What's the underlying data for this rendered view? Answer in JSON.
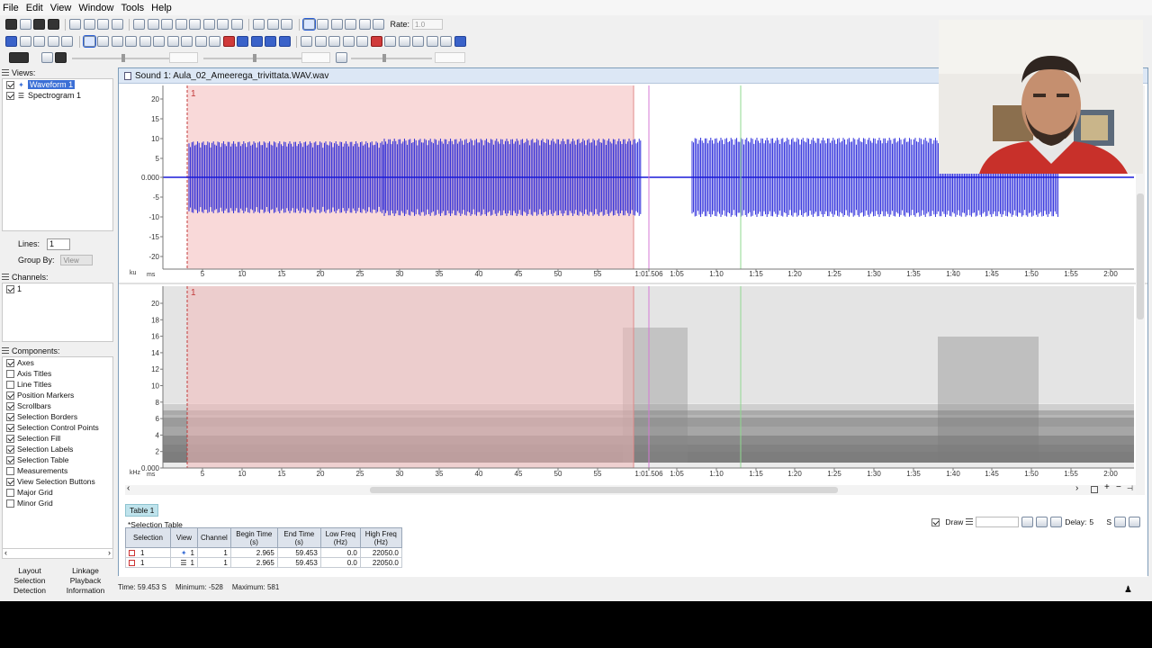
{
  "menubar": [
    "File",
    "Edit",
    "View",
    "Window",
    "Tools",
    "Help"
  ],
  "toolbar": {
    "rate_label": "Rate:",
    "rate_value": "1.0"
  },
  "left_panel": {
    "views_header": "Views:",
    "views": [
      {
        "label": "Waveform 1",
        "checked": true,
        "selected": true
      },
      {
        "label": "Spectrogram 1",
        "checked": true,
        "selected": false
      }
    ],
    "lines_label": "Lines:",
    "lines_value": "1",
    "group_by_label": "Group By:",
    "group_by_value": "View",
    "channels_header": "Channels:",
    "channels": [
      {
        "label": "1",
        "checked": true
      }
    ],
    "components_header": "Components:",
    "components": [
      {
        "label": "Axes",
        "checked": true
      },
      {
        "label": "Axis Titles",
        "checked": false
      },
      {
        "label": "Line Titles",
        "checked": false
      },
      {
        "label": "Position Markers",
        "checked": true
      },
      {
        "label": "Scrollbars",
        "checked": true
      },
      {
        "label": "Selection Borders",
        "checked": true
      },
      {
        "label": "Selection Control Points",
        "checked": true
      },
      {
        "label": "Selection Fill",
        "checked": true
      },
      {
        "label": "Selection Labels",
        "checked": true
      },
      {
        "label": "Selection Table",
        "checked": true
      },
      {
        "label": "Measurements",
        "checked": false
      },
      {
        "label": "View Selection Buttons",
        "checked": true
      },
      {
        "label": "Major Grid",
        "checked": false
      },
      {
        "label": "Minor Grid",
        "checked": false
      }
    ],
    "bottom_tabs": [
      [
        "Layout",
        "Linkage"
      ],
      [
        "Selection",
        "Playback"
      ],
      [
        "Detection",
        "Information"
      ]
    ]
  },
  "sound_window": {
    "title": "Sound 1: Aula_02_Ameerega_trivittata.WAV.wav",
    "waveform": {
      "y_ticks": [
        "20",
        "15",
        "10",
        "5",
        "0.000",
        "-5",
        "-10",
        "-15",
        "-20"
      ],
      "y_unit": "ku",
      "selection_label": "1"
    },
    "spectrogram": {
      "y_ticks": [
        "20",
        "18",
        "16",
        "14",
        "12",
        "10",
        "8",
        "6",
        "4",
        "2",
        "0.000"
      ],
      "y_unit": "kHz",
      "selection_label": "1"
    },
    "x_ticks": [
      "5",
      "10",
      "15",
      "20",
      "25",
      "30",
      "35",
      "40",
      "45",
      "50",
      "55",
      "1:01.506",
      "1:05",
      "1:10",
      "1:15",
      "1:20",
      "1:25",
      "1:30",
      "1:35",
      "1:40",
      "1:45",
      "1:50",
      "1:55",
      "2:00"
    ],
    "x_unit": "ms"
  },
  "selection_table": {
    "tab": "Table 1",
    "title": "*Selection Table",
    "draw_label": "Draw",
    "delay_label": "Delay:",
    "delay_value": "5",
    "delay_unit": "S",
    "columns": [
      "Selection",
      "View",
      "Channel",
      "Begin Time\n(s)",
      "End Time\n(s)",
      "Low Freq\n(Hz)",
      "High Freq\n(Hz)"
    ],
    "rows": [
      [
        "1",
        "1",
        "1",
        "2.965",
        "59.453",
        "0.0",
        "22050.0"
      ],
      [
        "1",
        "1",
        "1",
        "2.965",
        "59.453",
        "0.0",
        "22050.0"
      ]
    ]
  },
  "status": {
    "time": "Time: 59.453 S",
    "minimum": "Minimum:  -528",
    "maximum": "Maximum:  581"
  },
  "colors": {
    "waveform": "#1a1ad8",
    "selection_fill": "#f9d9d9",
    "selection_border": "#c23a3a",
    "accent": "#3b6fd6"
  }
}
